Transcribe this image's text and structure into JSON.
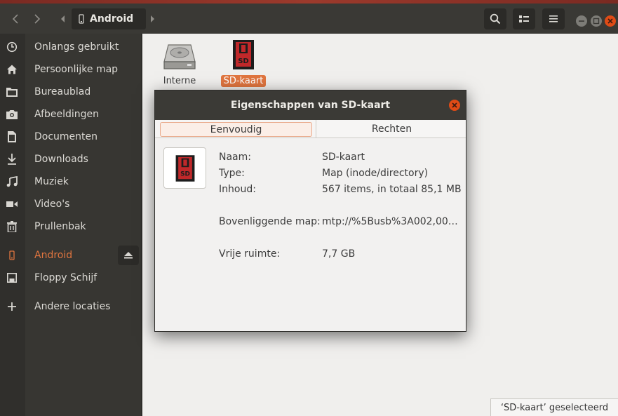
{
  "header": {
    "location": "Android",
    "icons": [
      "back-icon",
      "forward-icon",
      "phone-icon",
      "search-icon",
      "view-options-icon",
      "menu-icon"
    ]
  },
  "sidebar": {
    "items": [
      {
        "label": "Onlangs gebruikt",
        "icon": "clock-icon"
      },
      {
        "label": "Persoonlijke map",
        "icon": "home-icon"
      },
      {
        "label": "Bureaublad",
        "icon": "folder-icon"
      },
      {
        "label": "Afbeeldingen",
        "icon": "camera-icon"
      },
      {
        "label": "Documenten",
        "icon": "document-icon"
      },
      {
        "label": "Downloads",
        "icon": "download-icon"
      },
      {
        "label": "Muziek",
        "icon": "music-icon"
      },
      {
        "label": "Video's",
        "icon": "video-icon"
      },
      {
        "label": "Prullenbak",
        "icon": "trash-icon"
      }
    ],
    "devices": [
      {
        "label": "Android",
        "icon": "phone-icon",
        "active": true
      },
      {
        "label": "Floppy Schijf",
        "icon": "floppy-icon"
      }
    ],
    "other": {
      "label": "Andere locaties",
      "icon": "plus-icon"
    }
  },
  "files": [
    {
      "name": "Interne opslag",
      "icon": "harddisk-icon"
    },
    {
      "name": "SD-kaart",
      "icon": "sdcard-icon",
      "selected": true
    }
  ],
  "status": "‘SD-kaart’ geselecteerd",
  "dialog": {
    "title": "Eigenschappen van SD-kaart",
    "tabs": [
      "Eenvoudig",
      "Rechten"
    ],
    "props": {
      "name_k": "Naam:",
      "name_v": "SD-kaart",
      "type_k": "Type:",
      "type_v": "Map (inode/directory)",
      "contents_k": "Inhoud:",
      "contents_v": "567 items, in totaal 85,1 MB",
      "parent_k": "Bovenliggende map:",
      "parent_v": "mtp://%5Busb%3A002,00…",
      "free_k": "Vrije ruimte:",
      "free_v": "7,7 GB"
    }
  },
  "colors": {
    "accent": "#e0753f",
    "close": "#df4b16",
    "header": "#3a3935",
    "sidebar": "#373632"
  }
}
